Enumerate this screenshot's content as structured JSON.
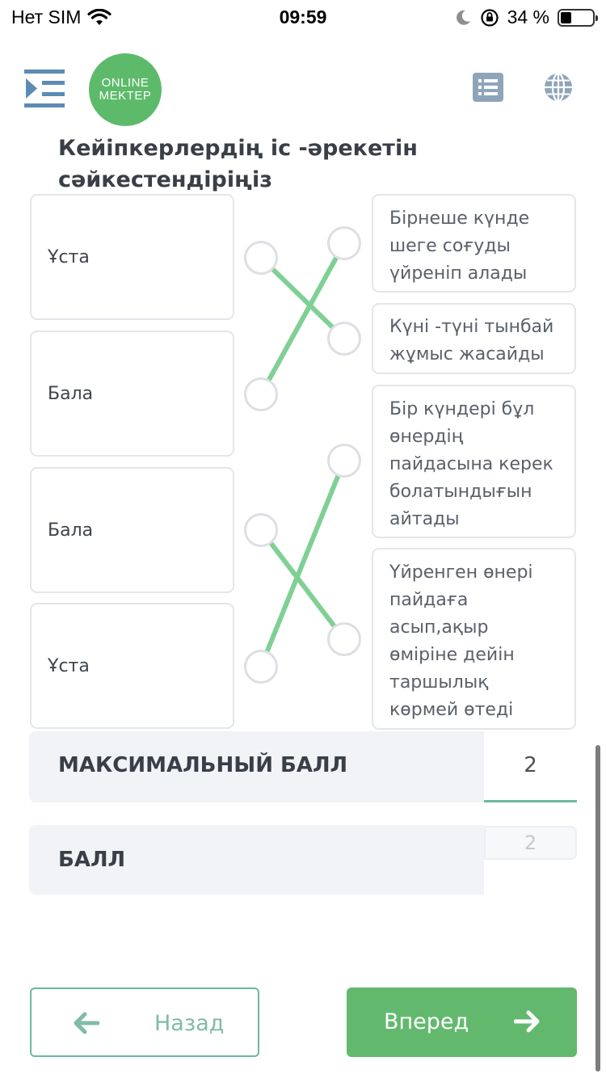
{
  "status_bar": {
    "carrier": "Нет SIM",
    "time": "09:59",
    "battery_percent": "34 %",
    "battery_level": 0.34
  },
  "header": {
    "logo_line1": "ONLINE",
    "logo_line2": "MEKTEP",
    "brand_color": "#5eba6b"
  },
  "question": {
    "title": "Кейіпкерлердің іс -әрекетін сәйкестендіріңіз"
  },
  "matching": {
    "left_items": [
      "Ұста",
      "Бала",
      "Бала",
      "Ұста"
    ],
    "right_items": [
      "Бірнеше күнде шеге соғуды үйреніп алады",
      "Күні -түні тынбай жұмыс жасайды",
      "Бір күндері бұл өнердің пайдасына керек болатындығын айтады",
      "Үйренген өнері пайдаға асып,ақыр өміріне дейін таршылық көрмей өтеді"
    ],
    "connections": [
      [
        1,
        2
      ],
      [
        2,
        1
      ],
      [
        3,
        4
      ],
      [
        4,
        3
      ]
    ],
    "line_color": "#7fd094"
  },
  "score": {
    "max_label": "МАКСИМАЛЬНЫЙ БАЛЛ",
    "max_value": "2",
    "score_label": "БАЛЛ",
    "score_value": "2"
  },
  "nav": {
    "back_label": "Назад",
    "next_label": "Вперед"
  }
}
